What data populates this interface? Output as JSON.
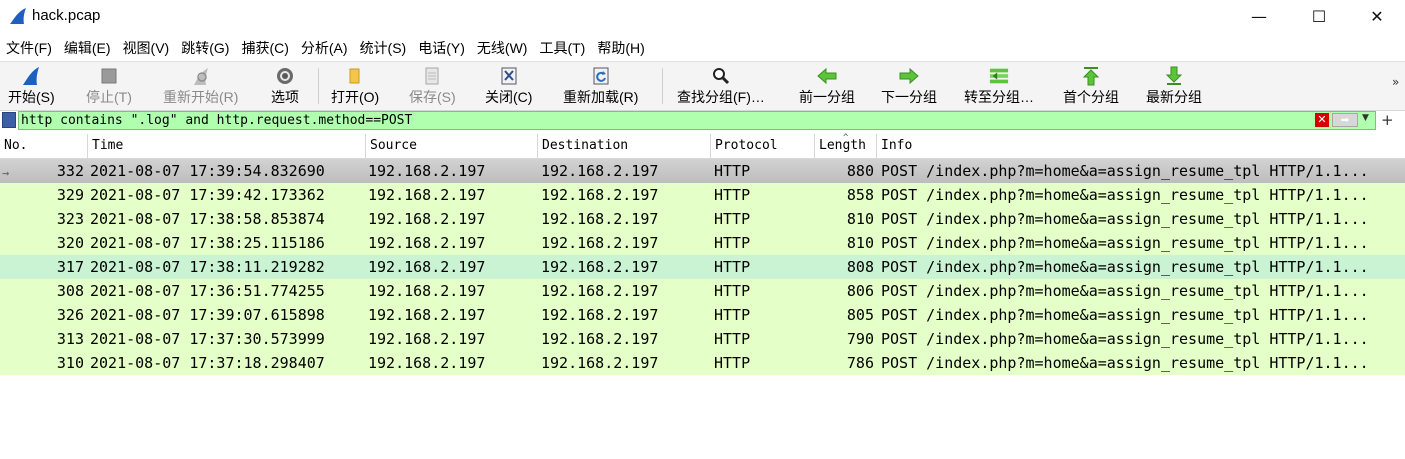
{
  "window": {
    "title": "hack.pcap",
    "minimize_label": "—",
    "maximize_label": "☐",
    "close_label": "✕"
  },
  "menu": {
    "items": [
      {
        "label": "文件(F)"
      },
      {
        "label": "编辑(E)"
      },
      {
        "label": "视图(V)"
      },
      {
        "label": "跳转(G)"
      },
      {
        "label": "捕获(C)"
      },
      {
        "label": "分析(A)"
      },
      {
        "label": "统计(S)"
      },
      {
        "label": "电话(Y)"
      },
      {
        "label": "无线(W)"
      },
      {
        "label": "工具(T)"
      },
      {
        "label": "帮助(H)"
      }
    ]
  },
  "toolbar": {
    "buttons": [
      {
        "label": "开始(S)",
        "icon": "shark-fin-icon",
        "enabled": true
      },
      {
        "label": "停止(T)",
        "icon": "stop-square-icon",
        "enabled": false
      },
      {
        "label": "重新开始(R)",
        "icon": "restart-fin-icon",
        "enabled": false
      },
      {
        "label": "选项",
        "icon": "gear-icon",
        "enabled": true
      },
      {
        "label": "打开(O)",
        "icon": "folder-icon",
        "enabled": true
      },
      {
        "label": "保存(S)",
        "icon": "save-file-icon",
        "enabled": false
      },
      {
        "label": "关闭(C)",
        "icon": "close-file-icon",
        "enabled": true
      },
      {
        "label": "重新加载(R)",
        "icon": "reload-icon",
        "enabled": true
      },
      {
        "label": "查找分组(F)…",
        "icon": "magnifier-icon",
        "enabled": true
      },
      {
        "label": "前一分组",
        "icon": "arrow-left-icon",
        "enabled": true
      },
      {
        "label": "下一分组",
        "icon": "arrow-right-icon",
        "enabled": true
      },
      {
        "label": "转至分组…",
        "icon": "go-to-packet-icon",
        "enabled": true
      },
      {
        "label": "首个分组",
        "icon": "arrow-up-icon",
        "enabled": true
      },
      {
        "label": "最新分组",
        "icon": "arrow-down-icon",
        "enabled": true
      }
    ],
    "more_label": "»"
  },
  "filter": {
    "value": "http contains \".log\" and http.request.method==POST",
    "clear_label": "✕",
    "apply_label": "➡",
    "dropdown_label": "▼",
    "add_label": "+",
    "color_valid": "#afffaf"
  },
  "packet_list": {
    "columns": [
      "No.",
      "Time",
      "Source",
      "Destination",
      "Protocol",
      "Length",
      "Info"
    ],
    "sort_indicator": "^",
    "row_color": "#e4ffc7",
    "rows": [
      {
        "no": "332",
        "time": "2021-08-07 17:39:54.832690",
        "source": "192.168.2.197",
        "destination": "192.168.2.197",
        "protocol": "HTTP",
        "length": "880",
        "info": "POST /index.php?m=home&a=assign_resume_tpl HTTP/1.1..."
      },
      {
        "no": "329",
        "time": "2021-08-07 17:39:42.173362",
        "source": "192.168.2.197",
        "destination": "192.168.2.197",
        "protocol": "HTTP",
        "length": "858",
        "info": "POST /index.php?m=home&a=assign_resume_tpl HTTP/1.1..."
      },
      {
        "no": "323",
        "time": "2021-08-07 17:38:58.853874",
        "source": "192.168.2.197",
        "destination": "192.168.2.197",
        "protocol": "HTTP",
        "length": "810",
        "info": "POST /index.php?m=home&a=assign_resume_tpl HTTP/1.1..."
      },
      {
        "no": "320",
        "time": "2021-08-07 17:38:25.115186",
        "source": "192.168.2.197",
        "destination": "192.168.2.197",
        "protocol": "HTTP",
        "length": "810",
        "info": "POST /index.php?m=home&a=assign_resume_tpl HTTP/1.1..."
      },
      {
        "no": "317",
        "time": "2021-08-07 17:38:11.219282",
        "source": "192.168.2.197",
        "destination": "192.168.2.197",
        "protocol": "HTTP",
        "length": "808",
        "info": "POST /index.php?m=home&a=assign_resume_tpl HTTP/1.1..."
      },
      {
        "no": "308",
        "time": "2021-08-07 17:36:51.774255",
        "source": "192.168.2.197",
        "destination": "192.168.2.197",
        "protocol": "HTTP",
        "length": "806",
        "info": "POST /index.php?m=home&a=assign_resume_tpl HTTP/1.1..."
      },
      {
        "no": "326",
        "time": "2021-08-07 17:39:07.615898",
        "source": "192.168.2.197",
        "destination": "192.168.2.197",
        "protocol": "HTTP",
        "length": "805",
        "info": "POST /index.php?m=home&a=assign_resume_tpl HTTP/1.1..."
      },
      {
        "no": "313",
        "time": "2021-08-07 17:37:30.573999",
        "source": "192.168.2.197",
        "destination": "192.168.2.197",
        "protocol": "HTTP",
        "length": "790",
        "info": "POST /index.php?m=home&a=assign_resume_tpl HTTP/1.1..."
      },
      {
        "no": "310",
        "time": "2021-08-07 17:37:18.298407",
        "source": "192.168.2.197",
        "destination": "192.168.2.197",
        "protocol": "HTTP",
        "length": "786",
        "info": "POST /index.php?m=home&a=assign_resume_tpl HTTP/1.1..."
      }
    ]
  }
}
